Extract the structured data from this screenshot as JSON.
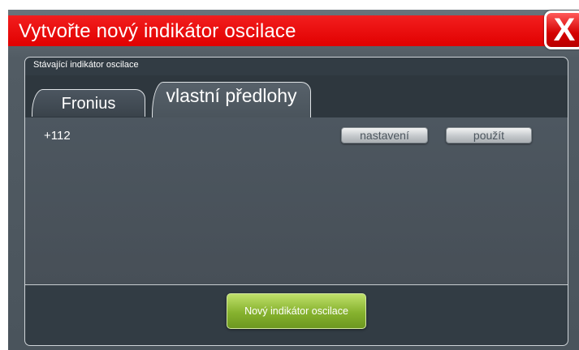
{
  "window": {
    "title": "Vytvořte nový indikátor oscilace",
    "close_label": "X"
  },
  "panel": {
    "title": "Stávající indikátor oscilace",
    "tabs": [
      {
        "label": "Fronius",
        "active": false
      },
      {
        "label": "vlastní předlohy",
        "active": true
      }
    ],
    "items": [
      {
        "name": "+112",
        "settings_label": "nastavení",
        "apply_label": "použít"
      }
    ]
  },
  "footer": {
    "new_button_label": "Nový indikátor oscilace"
  },
  "colors": {
    "title_bar": "#e60000",
    "panel_bg": "#323c44",
    "content_bg": "#4a545c",
    "primary_button": "#86b22e"
  }
}
